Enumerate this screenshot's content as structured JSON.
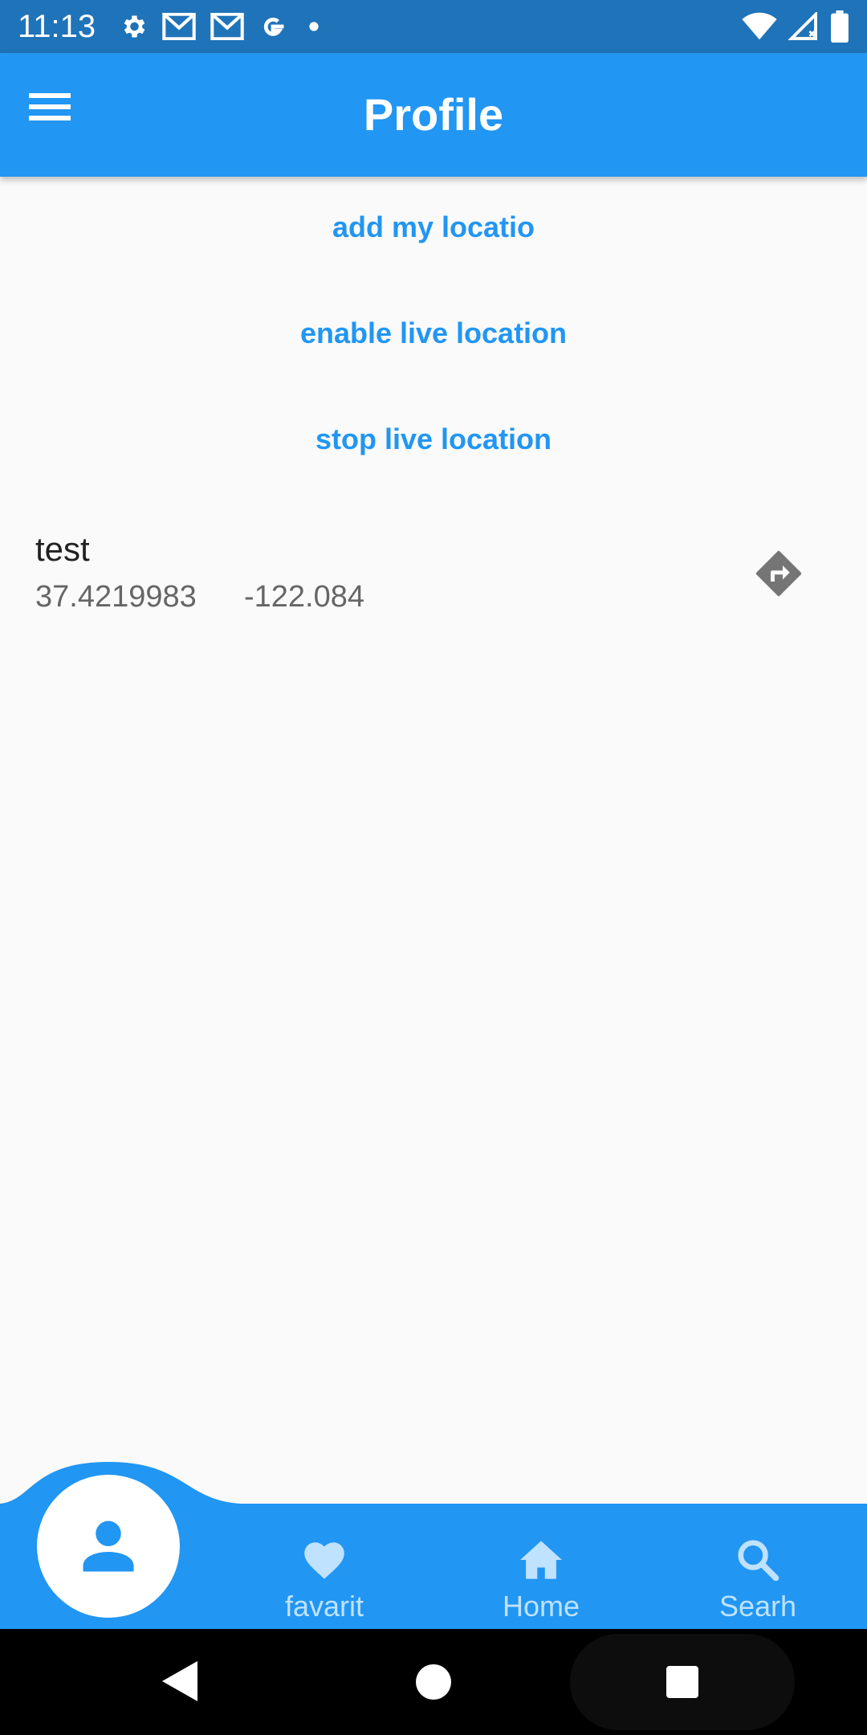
{
  "status_bar": {
    "time": "11:13",
    "left_icons": [
      "settings-icon",
      "gmail-icon",
      "gmail-icon",
      "google-icon",
      "notification-dot-icon"
    ],
    "right_icons": [
      "wifi-icon",
      "cell-signal-icon",
      "battery-icon"
    ]
  },
  "app_bar": {
    "title": "Profile",
    "menu_icon": "menu-icon",
    "color": "#2196f3"
  },
  "actions": {
    "add_location": "add my locatio",
    "enable_live": "enable live location",
    "stop_live": "stop live location"
  },
  "location": {
    "name": "test",
    "latitude": "37.4219983",
    "longitude": "-122.084",
    "action_icon": "directions-icon"
  },
  "bottom_nav": {
    "active_icon": "person-icon",
    "items": [
      {
        "label": "favarit",
        "icon": "heart-icon"
      },
      {
        "label": "Home",
        "icon": "home-icon"
      },
      {
        "label": "Searh",
        "icon": "search-icon"
      }
    ]
  },
  "system_nav": [
    "back-icon",
    "home-circle-icon",
    "recents-icon"
  ],
  "colors": {
    "primary": "#2196f3",
    "status_bar": "#1f73b8",
    "inactive_nav": "#bfe2ff",
    "background": "#fafafa"
  }
}
